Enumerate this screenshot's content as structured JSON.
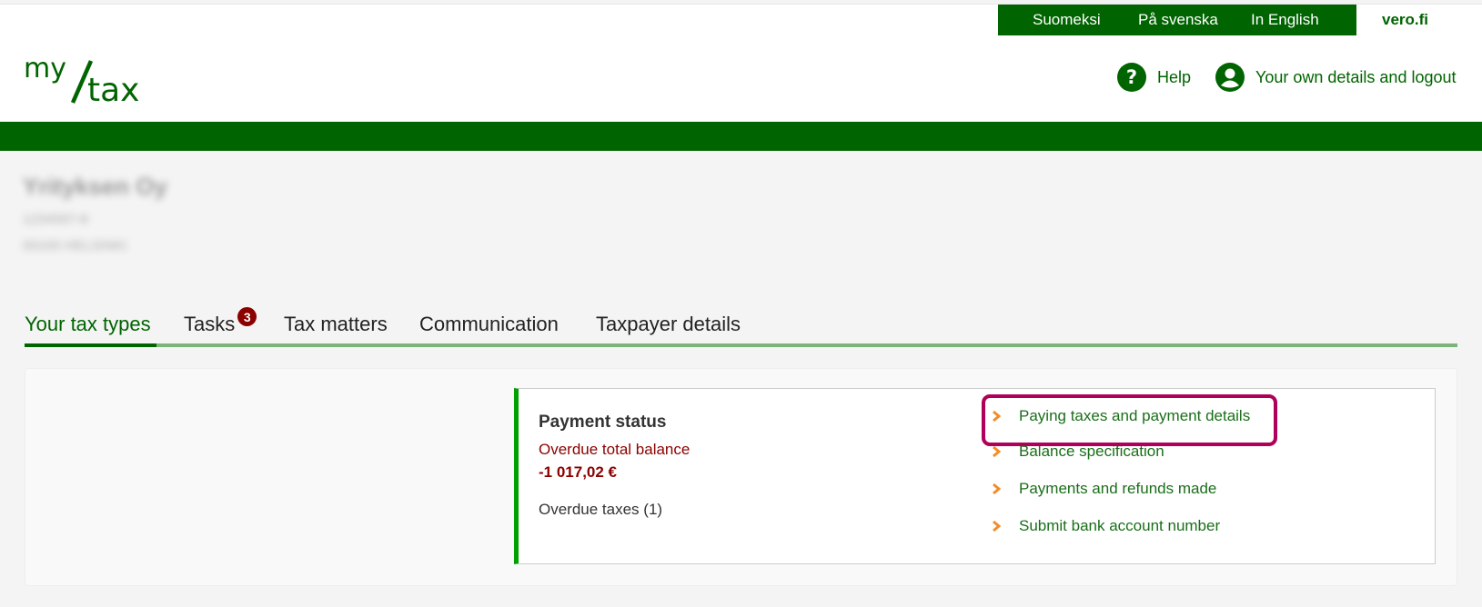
{
  "header": {
    "logo_text": "my/tax",
    "languages": [
      {
        "label": "Suomeksi"
      },
      {
        "label": "På svenska"
      },
      {
        "label": "In English"
      }
    ],
    "external_link": "vero.fi",
    "help_label": "Help",
    "account_label": "Your own details and logout"
  },
  "taxpayer": {
    "name": "Yrityksen Oy",
    "id": "1234567-8",
    "address": "00100 HELSINKI"
  },
  "tabs": [
    {
      "label": "Your tax types",
      "active": true
    },
    {
      "label": "Tasks",
      "badge": "3"
    },
    {
      "label": "Tax matters"
    },
    {
      "label": "Communication"
    },
    {
      "label": "Taxpayer details"
    }
  ],
  "payment_status": {
    "title": "Payment status",
    "balance_label": "Overdue total balance",
    "balance_amount": "-1 017,02 €",
    "overdue_taxes": "Overdue taxes (1)"
  },
  "links": [
    {
      "label": "Paying taxes and payment details",
      "highlighted": true
    },
    {
      "label": "Balance specification"
    },
    {
      "label": "Payments and refunds made"
    },
    {
      "label": "Submit bank account number"
    }
  ],
  "colors": {
    "brand_green": "#006400",
    "accent_green": "#00a000",
    "tab_line": "#7ab47a",
    "alert_red": "#8b0000",
    "chevron_orange": "#f28c28",
    "highlight_magenta": "#b0005a"
  }
}
